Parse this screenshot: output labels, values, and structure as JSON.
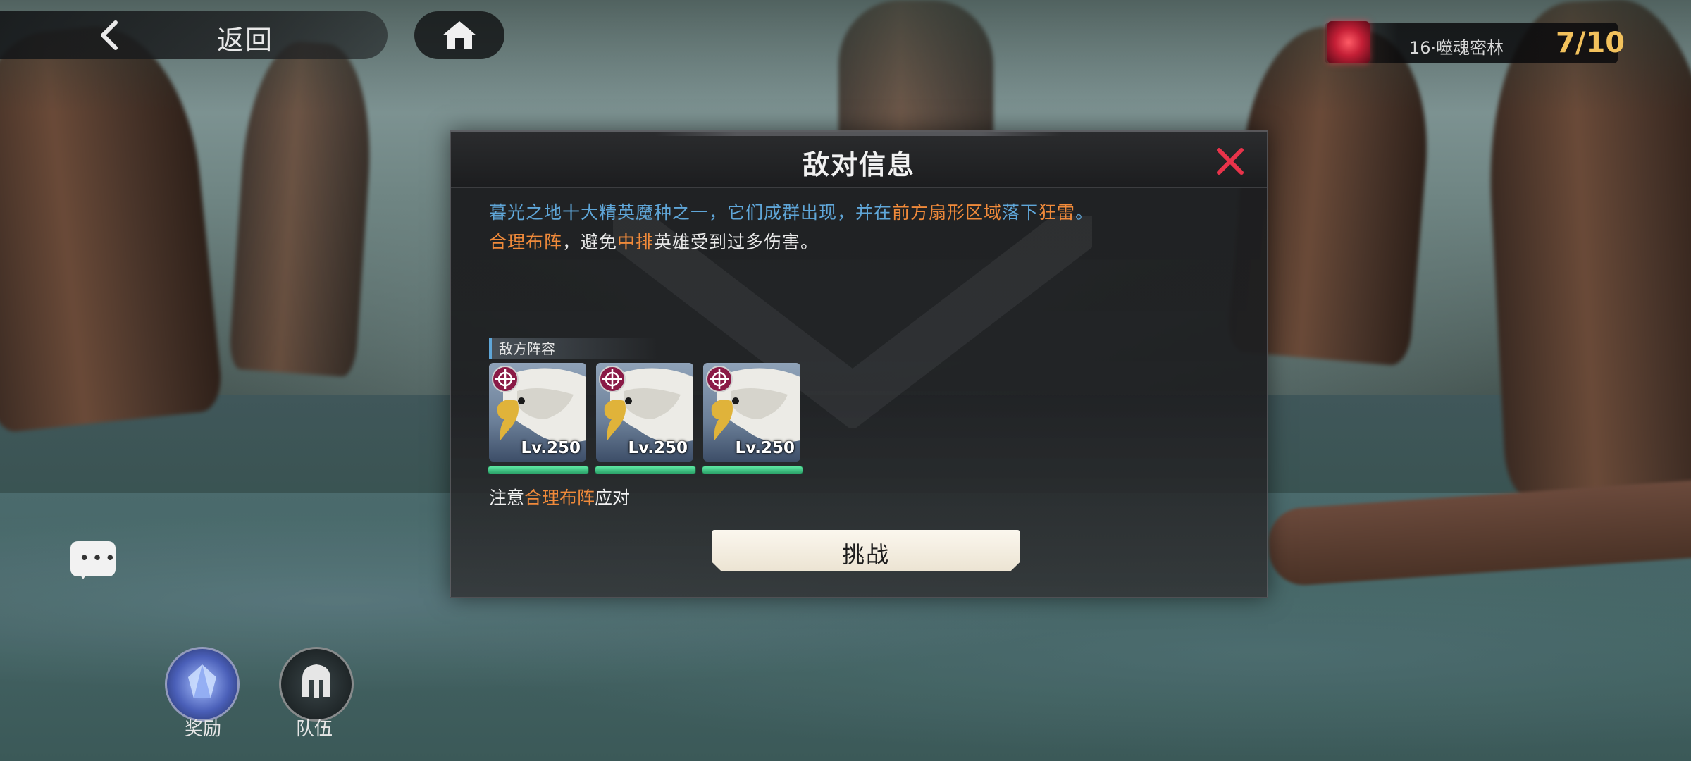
{
  "nav": {
    "back_label": "返回"
  },
  "progress": {
    "stage_name": "16·噬魂密林",
    "count": "7/10"
  },
  "side": {
    "reward_label": "奖励",
    "team_label": "队伍"
  },
  "dialog": {
    "title": "敌对信息",
    "desc_line1_a": "暮光之地十大精英魔种之一，它们成群出现，并在",
    "desc_line1_b": "前方扇形区域",
    "desc_line1_c": "落下",
    "desc_line1_d": "狂雷",
    "desc_line1_e": "。",
    "desc_line2_a": "合理布阵",
    "desc_line2_b": "，避免",
    "desc_line2_c": "中排",
    "desc_line2_d": "英雄受到过多伤害。",
    "lineup_label": "敌方阵容",
    "enemies": [
      {
        "level": "Lv.250",
        "hp_percent": 100
      },
      {
        "level": "Lv.250",
        "hp_percent": 100
      },
      {
        "level": "Lv.250",
        "hp_percent": 100
      }
    ],
    "note_a": "注意",
    "note_b": "合理布阵",
    "note_c": "应对",
    "challenge_label": "挑战"
  },
  "colors": {
    "desc_blue": "#5fa6d8",
    "highlight_orange": "#f08a3a",
    "hp_green": "#3fcf88",
    "close_red": "#e8334a",
    "count_gold": "#f2c15c"
  }
}
